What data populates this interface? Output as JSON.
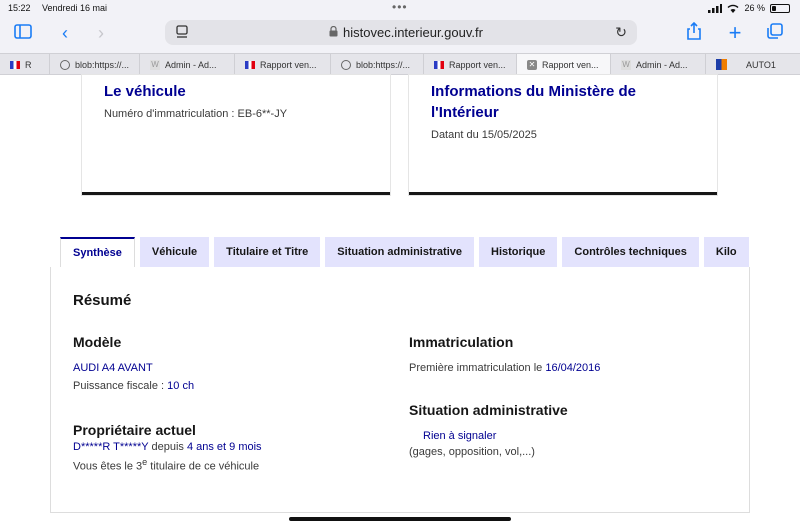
{
  "status": {
    "time": "15:22",
    "date": "Vendredi 16 mai",
    "battery": "26 %",
    "battery_level": 0.26
  },
  "browser": {
    "url": "histovec.interieur.gouv.fr",
    "tabs": [
      {
        "label": "R",
        "icon": "flag"
      },
      {
        "label": "blob:https://...",
        "icon": "globe"
      },
      {
        "label": "Admin - Ad...",
        "icon": "w"
      },
      {
        "label": "Rapport ven...",
        "icon": "flag"
      },
      {
        "label": "blob:https://...",
        "icon": "globe"
      },
      {
        "label": "Rapport ven...",
        "icon": "flag"
      },
      {
        "label": "Rapport ven...",
        "icon": "x",
        "active": true
      },
      {
        "label": "Admin - Ad...",
        "icon": "w"
      },
      {
        "label": "AUTO1",
        "icon": "auto1"
      }
    ]
  },
  "cards": {
    "vehicle": {
      "title": "Le véhicule",
      "plate_label": "Numéro d'immatriculation : EB-6**-JY"
    },
    "ministry": {
      "title_line1": "Informations du Ministère de",
      "title_line2": "l'Intérieur",
      "date_label": "Datant du 15/05/2025"
    }
  },
  "tabnav": [
    "Synthèse",
    "Véhicule",
    "Titulaire et Titre",
    "Situation administrative",
    "Historique",
    "Contrôles techniques",
    "Kilo"
  ],
  "summary": {
    "title": "Résumé",
    "model": {
      "heading": "Modèle",
      "name": "AUDI A4 AVANT",
      "power_label": "Puissance fiscale : ",
      "power_value": "10 ch"
    },
    "owner": {
      "heading": "Propriétaire actuel",
      "name": "D*****R T*****Y",
      "since_label": " depuis ",
      "duration": "4 ans et 9 mois",
      "rank_prefix": "Vous êtes le ",
      "rank": "3",
      "rank_sup": "e",
      "rank_suffix": " titulaire de ce véhicule"
    },
    "registration": {
      "heading": "Immatriculation",
      "first_label": "Première immatriculation le ",
      "first_date": "16/04/2016"
    },
    "admin": {
      "heading": "Situation administrative",
      "status": "Rien à signaler",
      "detail": "(gages, opposition, vol,...)"
    }
  },
  "colors": {
    "primary": "#000091",
    "tab_bg": "#e3e3fd",
    "ios_blue": "#1a7cf5"
  }
}
